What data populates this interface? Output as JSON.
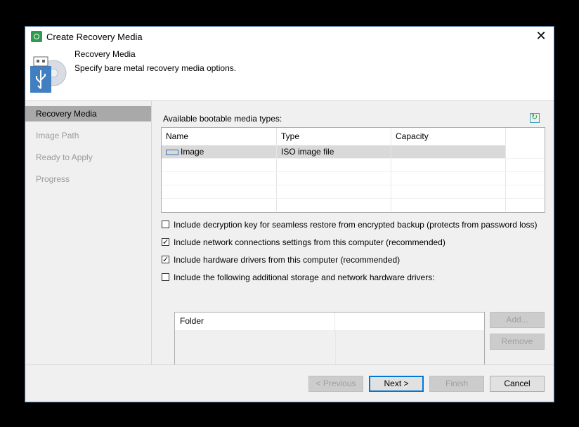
{
  "window": {
    "title": "Create Recovery Media",
    "close_glyph": "✕"
  },
  "header": {
    "title": "Recovery Media",
    "subtitle": "Specify bare metal recovery media options.",
    "icon": "usb-disc-icon"
  },
  "sidebar": {
    "items": [
      {
        "label": "Recovery Media",
        "active": true
      },
      {
        "label": "Image Path",
        "active": false
      },
      {
        "label": "Ready to Apply",
        "active": false
      },
      {
        "label": "Progress",
        "active": false
      }
    ]
  },
  "media": {
    "label": "Available bootable media types:",
    "columns": [
      "Name",
      "Type",
      "Capacity"
    ],
    "rows": [
      {
        "name": "Image",
        "type": "ISO image file",
        "capacity": ""
      }
    ]
  },
  "options": {
    "decryption_key": {
      "label": "Include decryption key for seamless restore from encrypted backup (protects from password loss)",
      "checked": false
    },
    "network_settings": {
      "label": "Include network connections settings from this computer (recommended)",
      "checked": true
    },
    "hardware_drivers": {
      "label": "Include hardware drivers from this computer (recommended)",
      "checked": true
    },
    "additional_drivers": {
      "label": "Include the following additional storage and network hardware drivers:",
      "checked": false
    }
  },
  "drivers": {
    "columns": [
      "Folder"
    ],
    "add_label": "Add...",
    "remove_label": "Remove"
  },
  "footer": {
    "previous_label": "< Previous",
    "next_label": "Next >",
    "finish_label": "Finish",
    "cancel_label": "Cancel"
  },
  "colors": {
    "accent": "#0078d7",
    "brand_green": "#2e9b4f",
    "panel_bg": "#f0f0f0",
    "active_sidebar": "#a9a9a9"
  }
}
